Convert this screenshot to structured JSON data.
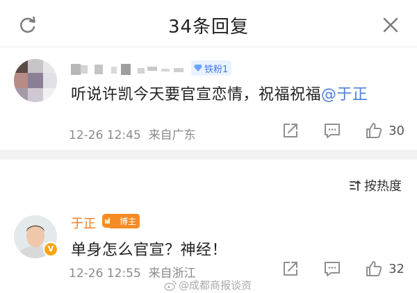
{
  "header": {
    "title": "34条回复"
  },
  "comment1": {
    "fan_badge": "铁粉1",
    "text_prefix": "听说许凯今天要官宣恋情，祝福祝福",
    "mention": "@于正",
    "time": "12-26 12:45",
    "source": "来自广东",
    "likes": "30"
  },
  "sort": {
    "label": "按热度"
  },
  "comment2": {
    "username": "于正",
    "badge": "博主",
    "text": "单身怎么官宣？神经！",
    "time": "12-26 12:55",
    "source": "来自浙江",
    "likes": "32",
    "verified_mark": "V"
  },
  "watermark": {
    "text": "@成都商报谈资"
  },
  "colors": {
    "mention": "#4a7fd8",
    "username": "#ef7c1e",
    "badge": "#f58b24",
    "fan_badge_bg": "#eaf2ff"
  },
  "icons": [
    "refresh-icon",
    "close-icon",
    "share-icon",
    "comment-icon",
    "like-icon",
    "sort-icon",
    "weibo-icon",
    "diamond-icon",
    "crown-icon"
  ]
}
